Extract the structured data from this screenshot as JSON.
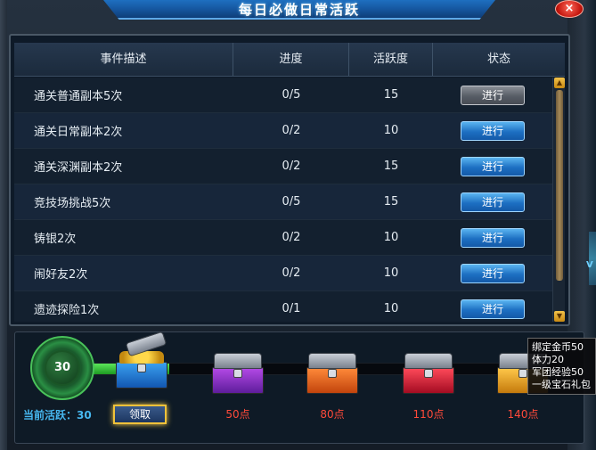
{
  "window": {
    "title": "每日必做日常活跃",
    "close_glyph": "×"
  },
  "table": {
    "headers": [
      "事件描述",
      "进度",
      "活跃度",
      "状态"
    ],
    "rows": [
      {
        "desc": "通关普通副本5次",
        "progress": "0/5",
        "activity": "15",
        "status": "进行",
        "style": "gray"
      },
      {
        "desc": "通关日常副本2次",
        "progress": "0/2",
        "activity": "10",
        "status": "进行",
        "style": "blue"
      },
      {
        "desc": "通关深渊副本2次",
        "progress": "0/2",
        "activity": "15",
        "status": "进行",
        "style": "blue"
      },
      {
        "desc": "竞技场挑战5次",
        "progress": "0/5",
        "activity": "15",
        "status": "进行",
        "style": "blue"
      },
      {
        "desc": "铸银2次",
        "progress": "0/2",
        "activity": "10",
        "status": "进行",
        "style": "blue"
      },
      {
        "desc": "闹好友2次",
        "progress": "0/2",
        "activity": "10",
        "status": "进行",
        "style": "blue"
      },
      {
        "desc": "遗迹探险1次",
        "progress": "0/1",
        "activity": "10",
        "status": "进行",
        "style": "blue"
      }
    ]
  },
  "reward": {
    "circle_value": "30",
    "current_label": "当前活跃：",
    "current_value": "30",
    "claim_label": "领取",
    "progress_fraction": 0.17,
    "chests": [
      {
        "label": "",
        "color": "blue",
        "opened": true
      },
      {
        "label": "50点",
        "color": "purple"
      },
      {
        "label": "80点",
        "color": "orange"
      },
      {
        "label": "110点",
        "color": "red"
      },
      {
        "label": "140点",
        "color": "gold"
      }
    ]
  },
  "tooltip": {
    "lines": [
      "绑定金币50",
      "体力20",
      "军团经验50",
      "一级宝石礼包"
    ]
  },
  "side_letter": "V"
}
